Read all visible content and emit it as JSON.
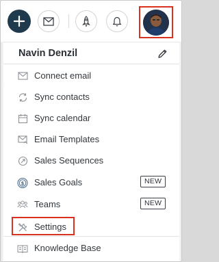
{
  "topbar": {
    "create_icon": "plus-icon",
    "mail_icon": "envelope-icon",
    "rocket_icon": "rocket-icon",
    "bell_icon": "bell-icon",
    "accent": "#1f3a4d",
    "highlight_color": "#d8321e"
  },
  "profile": {
    "name": "Navin Denzil",
    "edit_icon": "pencil-icon"
  },
  "menu": [
    {
      "label": "Connect email",
      "icon": "envelope-icon",
      "badge": ""
    },
    {
      "label": "Sync contacts",
      "icon": "sync-icon",
      "badge": ""
    },
    {
      "label": "Sync calendar",
      "icon": "calendar-icon",
      "badge": ""
    },
    {
      "label": "Email Templates",
      "icon": "email-template-icon",
      "badge": ""
    },
    {
      "label": "Sales Sequences",
      "icon": "sequence-icon",
      "badge": ""
    },
    {
      "label": "Sales Goals",
      "icon": "goals-icon",
      "badge": "NEW"
    },
    {
      "label": "Teams",
      "icon": "teams-icon",
      "badge": "NEW"
    },
    {
      "label": "Settings",
      "icon": "settings-icon",
      "badge": ""
    },
    {
      "label": "Knowledge Base",
      "icon": "book-icon",
      "badge": ""
    }
  ]
}
